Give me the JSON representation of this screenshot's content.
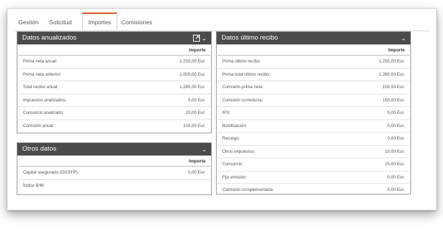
{
  "tabs": [
    {
      "label": "Gestión"
    },
    {
      "label": "Solicitud"
    },
    {
      "label": "Importes"
    },
    {
      "label": "Comisiones"
    }
  ],
  "active_tab": "Importes",
  "accent_color": "#d9532b",
  "header_color": "#4b4b4b",
  "panels": {
    "anualizados": {
      "title": "Datos anualizados",
      "column": "Importe",
      "rows": [
        {
          "label": "Prima neta anual:",
          "value": "1.250,00 Eur."
        },
        {
          "label": "Prima neta anterior:",
          "value": "1.000,00 Eur."
        },
        {
          "label": "Total recibo anual:",
          "value": "1.280,00 Eur."
        },
        {
          "label": "Impuestos analizados:",
          "value": "5,00 Eur."
        },
        {
          "label": "Consorcio analizado:",
          "value": "15,00 Eur."
        },
        {
          "label": "Comisión anual:",
          "value": "150,00 Eur."
        }
      ]
    },
    "otros": {
      "title": "Otros datos",
      "column": "Importe",
      "rows": [
        {
          "label": "Capital asegurado (DGSFP):",
          "value": "0,00 Eur."
        },
        {
          "label": "Índice B/M:",
          "value": ""
        }
      ]
    },
    "ultimo": {
      "title": "Datos último recibo",
      "column": "Importe",
      "rows": [
        {
          "label": "Prima último recibo:",
          "value": "1.250,00 Eur."
        },
        {
          "label": "Prima total último recibo:",
          "value": "1.280,00 Eur."
        },
        {
          "label": "Comisión prima neta:",
          "value": "150,00 Eur."
        },
        {
          "label": "Comisión correduría:",
          "value": "150,00 Eur."
        },
        {
          "label": "IPS:",
          "value": "5,00 Eur."
        },
        {
          "label": "Bonificación:",
          "value": "0,00 Eur."
        },
        {
          "label": "Recargo:",
          "value": "0,00 Eur."
        },
        {
          "label": "Otros impuestos:",
          "value": "10,00 Eur."
        },
        {
          "label": "Consorcio:",
          "value": "15,00 Eur."
        },
        {
          "label": "Fijo emisión:",
          "value": "0,00 Eur."
        },
        {
          "label": "Comisión complementaria:",
          "value": "0,00 Eur."
        }
      ]
    }
  },
  "icons": {
    "collapse": "chevron-down-icon",
    "external": "external-link-icon"
  }
}
